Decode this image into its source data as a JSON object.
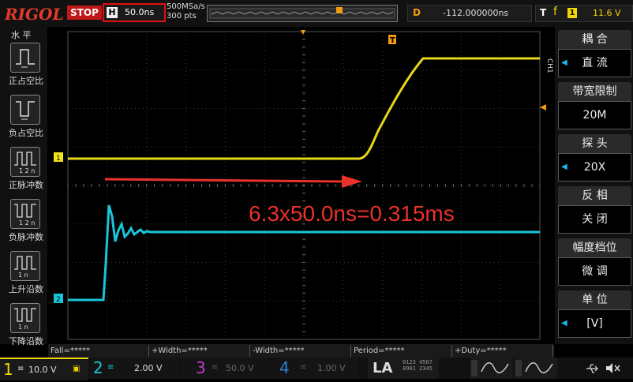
{
  "top": {
    "logo": "RIGOL",
    "status": "STOP",
    "horizontal_label": "H",
    "timebase": "50.0ns",
    "sample_rate": "500MSa/s",
    "memory_depth": "300 pts",
    "delay_label": "D",
    "delay_value": "-112.000000ns",
    "trigger_label": "T",
    "trigger_slope": "f",
    "trigger_channel": "1",
    "trigger_level": "11.6 V"
  },
  "left_menu": {
    "title": "水 平",
    "items": [
      {
        "label": "正占空比",
        "icon": "positive-duty-icon"
      },
      {
        "label": "负占空比",
        "icon": "negative-duty-icon"
      },
      {
        "label": "正脉冲数",
        "icon": "positive-pulse-count-icon"
      },
      {
        "label": "负脉冲数",
        "icon": "negative-pulse-count-icon"
      },
      {
        "label": "上升沿数",
        "icon": "rising-edge-count-icon"
      },
      {
        "label": "下降沿数",
        "icon": "falling-edge-count-icon"
      }
    ]
  },
  "right_menu": {
    "ch_tag": "CH1",
    "items": [
      {
        "head": "耦 合",
        "value": "直 流"
      },
      {
        "head": "带宽限制",
        "value": "20M"
      },
      {
        "head": "探 头",
        "value": "20X"
      },
      {
        "head": "反 相",
        "value": "关 闭"
      },
      {
        "head": "幅度档位",
        "value": "微 调"
      },
      {
        "head": "单 位",
        "value": "[V]"
      }
    ]
  },
  "screen": {
    "annotation": "6.3x50.0ns=0.315ms",
    "ch1_marker": "1",
    "ch2_marker": "2",
    "trigger_marker": "T",
    "colors": {
      "ch1": "#f1e21a",
      "ch2": "#19c6d8",
      "annotation": "#e8322a",
      "marker": "#f39c12"
    }
  },
  "measurements": [
    "Fall=*****",
    "+Width=*****",
    "-Width=*****",
    "Period=*****",
    "+Duty=*****"
  ],
  "channels": [
    {
      "num": "1",
      "scale": "10.0 V",
      "color": "#f1d600"
    },
    {
      "num": "2",
      "scale": "2.00 V",
      "color": "#19c6d8"
    },
    {
      "num": "3",
      "scale": "50.0 V",
      "color": "#c03ac8"
    },
    {
      "num": "4",
      "scale": "1.00 V",
      "color": "#2a7fd0"
    }
  ],
  "la": {
    "label": "LA"
  }
}
